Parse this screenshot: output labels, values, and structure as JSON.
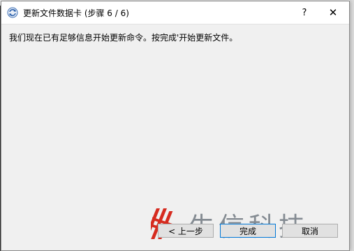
{
  "window": {
    "title": "更新文件数据卡 (步骤 6 / 6)",
    "help_label": "?",
    "close_label": "✕"
  },
  "content": {
    "message": "我们现在已有足够信息开始更新命令。按完成'开始更新文件。"
  },
  "buttons": {
    "back_label": "< 上一步",
    "finish_label": "完成",
    "cancel_label": "取消"
  },
  "watermark": {
    "text": "生信科技",
    "color": "#d62b1f"
  },
  "icons": {
    "app": "refresh-icon"
  }
}
